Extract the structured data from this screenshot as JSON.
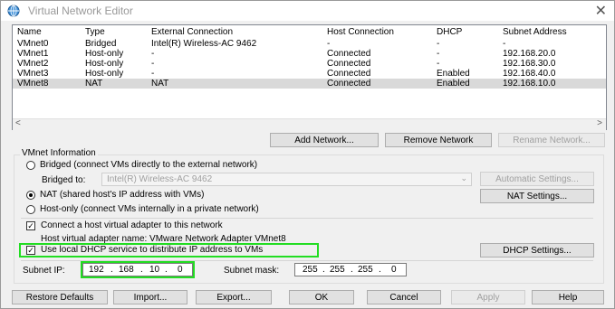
{
  "window": {
    "title": "Virtual Network Editor",
    "icon": "network-globe-icon",
    "close_glyph": "✕"
  },
  "network_list": {
    "columns": [
      "Name",
      "Type",
      "External Connection",
      "Host Connection",
      "DHCP",
      "Subnet Address"
    ],
    "rows": [
      [
        "VMnet0",
        "Bridged",
        "Intel(R) Wireless-AC 9462",
        "-",
        "-",
        "-"
      ],
      [
        "VMnet1",
        "Host-only",
        "-",
        "Connected",
        "-",
        "192.168.20.0"
      ],
      [
        "VMnet2",
        "Host-only",
        "-",
        "Connected",
        "-",
        "192.168.30.0"
      ],
      [
        "VMnet3",
        "Host-only",
        "-",
        "Connected",
        "Enabled",
        "192.168.40.0"
      ],
      [
        "VMnet8",
        "NAT",
        "NAT",
        "Connected",
        "Enabled",
        "192.168.10.0"
      ]
    ],
    "selected_row": 4
  },
  "list_buttons": {
    "add": "Add Network...",
    "remove": "Remove Network",
    "rename": "Rename Network..."
  },
  "vmnet_info": {
    "group_label": "VMnet Information",
    "bridged_label": "Bridged (connect VMs directly to the external network)",
    "bridged_to_label": "Bridged to:",
    "bridged_to_value": "Intel(R) Wireless-AC 9462",
    "auto_settings": "Automatic Settings...",
    "nat_label": "NAT (shared host's IP address with VMs)",
    "nat_settings": "NAT Settings...",
    "hostonly_label": "Host-only (connect VMs internally in a private network)",
    "connect_adapter_label": "Connect a host virtual adapter to this network",
    "adapter_name_label": "Host virtual adapter name: VMware Network Adapter VMnet8",
    "dhcp_label": "Use local DHCP service to distribute IP address to VMs",
    "dhcp_settings": "DHCP Settings...",
    "subnet_ip_label": "Subnet IP:",
    "subnet_ip": [
      "192",
      "168",
      "10",
      "0"
    ],
    "subnet_mask_label": "Subnet mask:",
    "subnet_mask": [
      "255",
      "255",
      "255",
      "0"
    ],
    "selected_mode": "NAT",
    "connect_adapter_checked": true,
    "dhcp_checked": true
  },
  "bottom_buttons": {
    "restore": "Restore Defaults",
    "import": "Import...",
    "export": "Export...",
    "ok": "OK",
    "cancel": "Cancel",
    "apply": "Apply",
    "help": "Help"
  },
  "colors": {
    "highlight": "#22dd22",
    "selected_row": "#d9d9d9"
  }
}
